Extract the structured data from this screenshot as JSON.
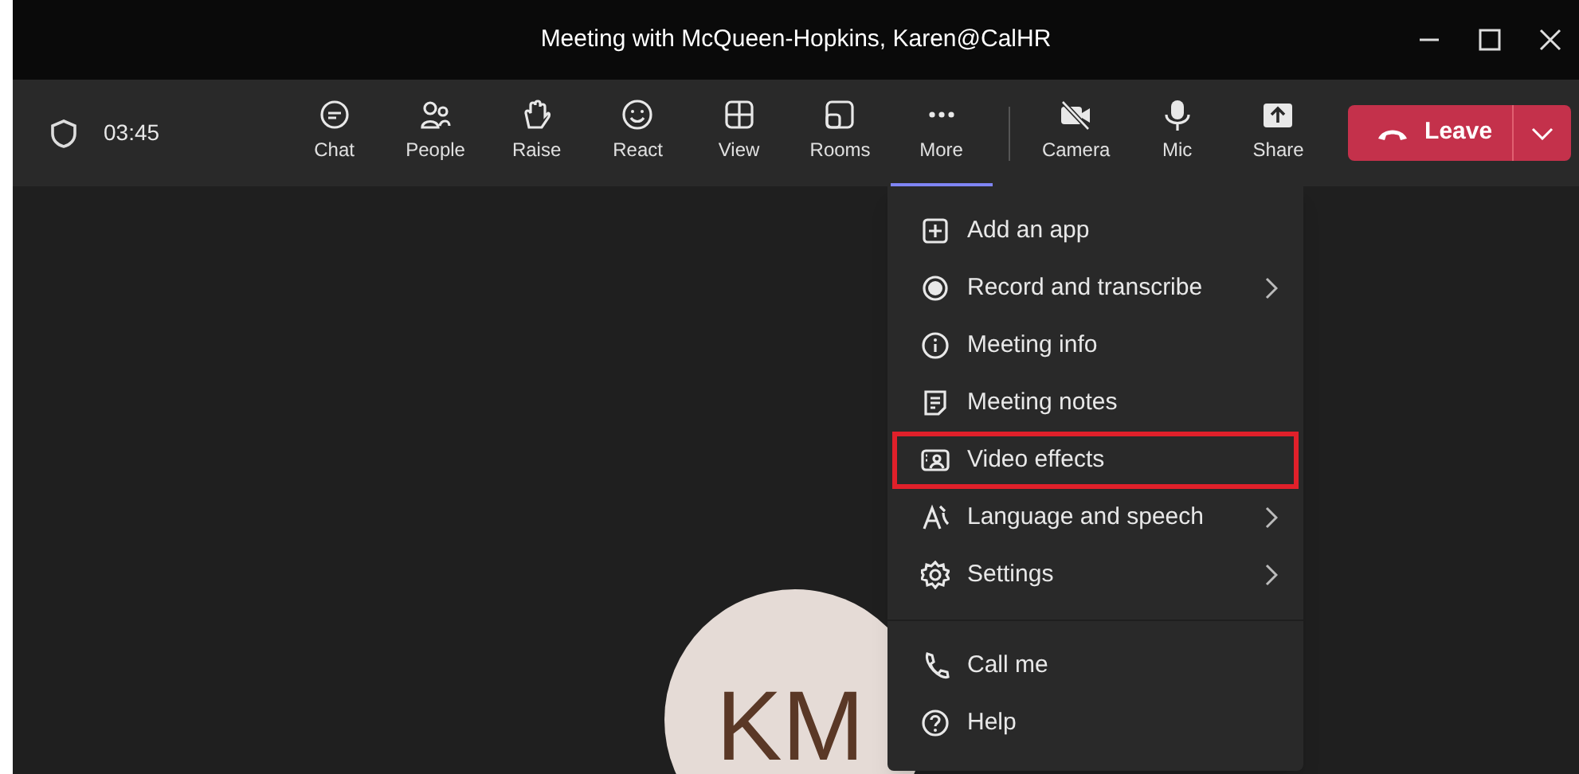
{
  "window": {
    "title": "Meeting with McQueen-Hopkins, Karen@CalHR"
  },
  "toolbar": {
    "timer": "03:45",
    "buttons": [
      {
        "kind": "chat",
        "label": "Chat",
        "selected": false
      },
      {
        "kind": "people",
        "label": "People",
        "selected": false
      },
      {
        "kind": "raise",
        "label": "Raise",
        "selected": false
      },
      {
        "kind": "react",
        "label": "React",
        "selected": false
      },
      {
        "kind": "view",
        "label": "View",
        "selected": false
      },
      {
        "kind": "rooms",
        "label": "Rooms",
        "selected": false
      },
      {
        "kind": "more",
        "label": "More",
        "selected": true
      },
      {
        "kind": "camera",
        "label": "Camera",
        "selected": false
      },
      {
        "kind": "mic",
        "label": "Mic",
        "selected": false
      },
      {
        "kind": "share",
        "label": "Share",
        "selected": false
      }
    ],
    "leave_button": "Leave"
  },
  "participant": {
    "initials": "KM"
  },
  "more_menu": {
    "items": [
      {
        "kind": "add",
        "label": "Add an app",
        "submenu": false,
        "highlighted": false
      },
      {
        "kind": "record",
        "label": "Record and transcribe",
        "submenu": true,
        "highlighted": false
      },
      {
        "kind": "info",
        "label": "Meeting info",
        "submenu": false,
        "highlighted": false
      },
      {
        "kind": "notes",
        "label": "Meeting notes",
        "submenu": false,
        "highlighted": false
      },
      {
        "kind": "effects",
        "label": "Video effects",
        "submenu": false,
        "highlighted": true
      },
      {
        "kind": "language",
        "label": "Language and speech",
        "submenu": true,
        "highlighted": false
      },
      {
        "kind": "settings",
        "label": "Settings",
        "submenu": true,
        "highlighted": false
      },
      {
        "kind": "divider"
      },
      {
        "kind": "call",
        "label": "Call me",
        "submenu": false,
        "highlighted": false
      },
      {
        "kind": "help",
        "label": "Help",
        "submenu": false,
        "highlighted": false
      }
    ]
  }
}
